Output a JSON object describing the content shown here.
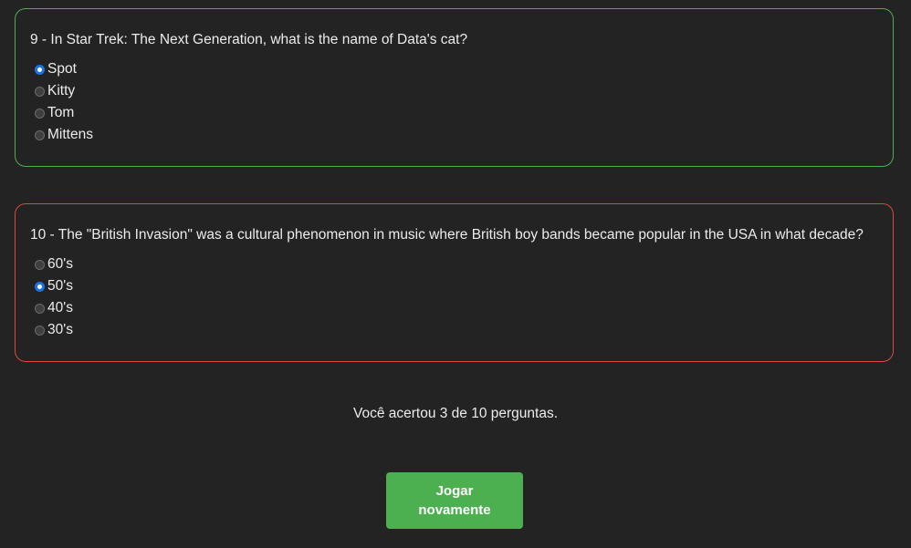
{
  "questions": [
    {
      "text": "9 - In Star Trek: The Next Generation, what is the name of Data's cat?",
      "status": "correct",
      "border_color": "#4caf50",
      "options": [
        {
          "label": "Spot",
          "selected": true
        },
        {
          "label": "Kitty",
          "selected": false
        },
        {
          "label": "Tom",
          "selected": false
        },
        {
          "label": "Mittens",
          "selected": false
        }
      ]
    },
    {
      "text": "10 - The \"British Invasion\" was a cultural phenomenon in music where British boy bands became popular in the USA in what decade?",
      "status": "wrong",
      "border_color": "#e0463a",
      "options": [
        {
          "label": "60's",
          "selected": false
        },
        {
          "label": "50's",
          "selected": true
        },
        {
          "label": "40's",
          "selected": false
        },
        {
          "label": "30's",
          "selected": false
        }
      ]
    }
  ],
  "result": {
    "text": "Você acertou 3 de 10 perguntas.",
    "correct": 3,
    "total": 10
  },
  "play_again": {
    "label": "Jogar novamente",
    "color": "#4caf50"
  },
  "colors": {
    "background": "#232323",
    "radio_selected": "#1a73e8"
  }
}
